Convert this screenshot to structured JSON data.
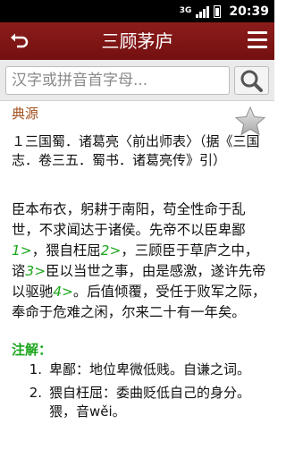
{
  "statusbar": {
    "network": "3G",
    "time": "20:39"
  },
  "header": {
    "title": "三顾茅庐"
  },
  "search": {
    "placeholder": "汉字或拼音首字母..."
  },
  "source": {
    "label": "典源",
    "text": "１三国蜀．诸葛亮〈前出师表〉（据《三国志．卷三五．蜀书．诸葛亮传》引）"
  },
  "article": {
    "p1": "臣本布衣，躬耕于南阳，苟全性命于乱世，不求闻达于诸侯。先帝不以臣卑鄙",
    "r1": "1>",
    "p2": "，猥自枉屈",
    "r2": "2>",
    "p3": "，三顾臣于草庐之中，谘",
    "r3": "3>",
    "p4": "臣以当世之事，由是感激，遂许先帝以驱驰",
    "r4": "4>",
    "p5": "。后值倾覆，受任于败军之际，奉命于危难之闲，尔来二十有一年矣。"
  },
  "notes": {
    "label": "注解：",
    "items": [
      {
        "num": "1.",
        "text": "卑鄙：地位卑微低贱。自谦之词。"
      },
      {
        "num": "2.",
        "text": "猥自枉屈：委曲贬低自己的身分。猥，音wěi。"
      }
    ]
  },
  "colors": {
    "header_bg": "#7e1515",
    "source_label": "#a3501c",
    "reference": "#1ba51b",
    "notes_label": "#1ba51b"
  },
  "icons": {
    "back": "back-arrow-icon",
    "menu": "menu-icon",
    "search": "search-icon",
    "favorite": "star-icon"
  }
}
